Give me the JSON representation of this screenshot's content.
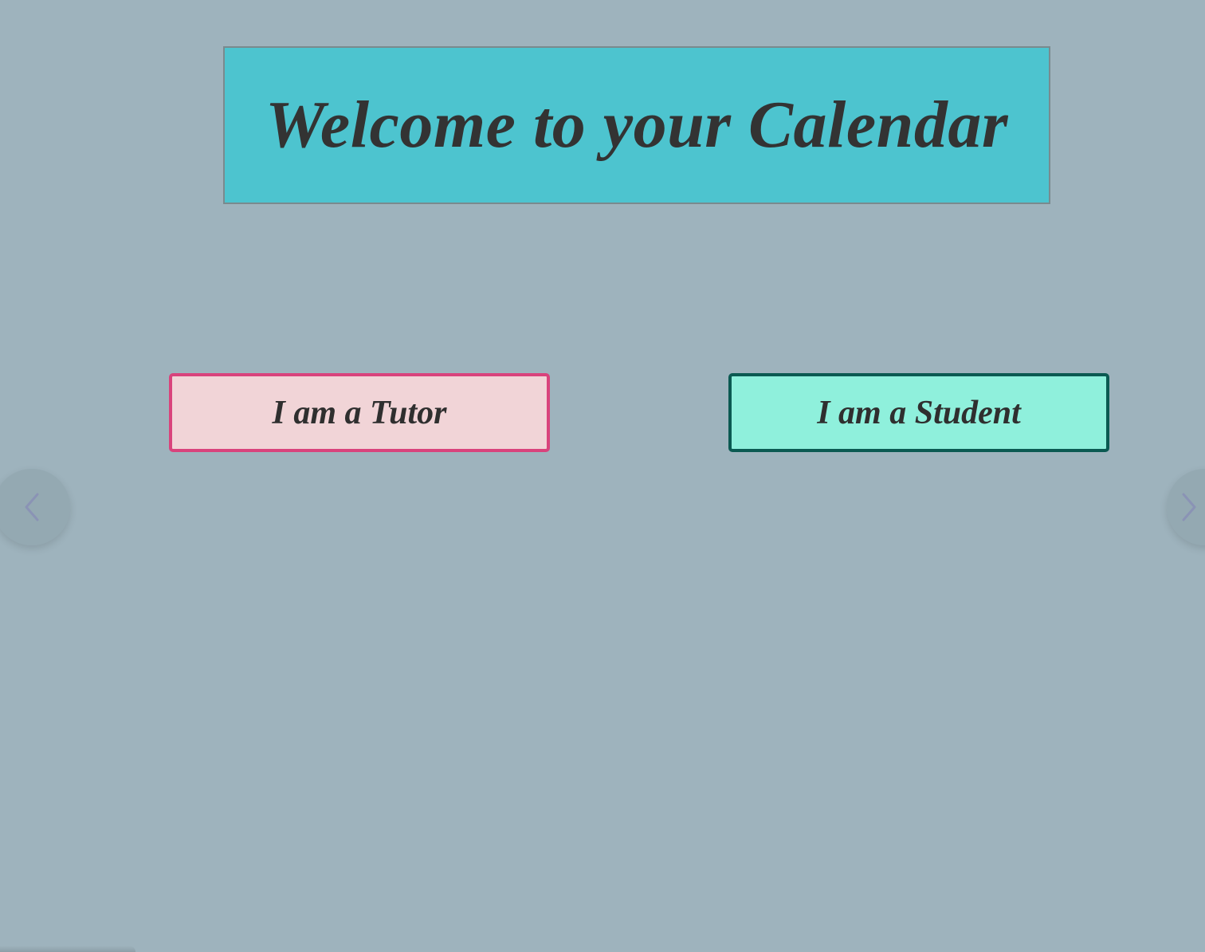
{
  "header": {
    "title": "Welcome to your Calendar"
  },
  "roles": {
    "tutor_label": "I am a Tutor",
    "student_label": "I am a Student"
  },
  "navigation": {
    "prev_icon": "chevron-left-icon",
    "next_icon": "chevron-right-icon"
  },
  "colors": {
    "background": "#9eb3bd",
    "title_bg": "#4dc4cf",
    "tutor_bg": "#f1d4d7",
    "tutor_border": "#d9437c",
    "student_bg": "#8ff0dc",
    "student_border": "#0b5a52",
    "text": "#333333"
  }
}
